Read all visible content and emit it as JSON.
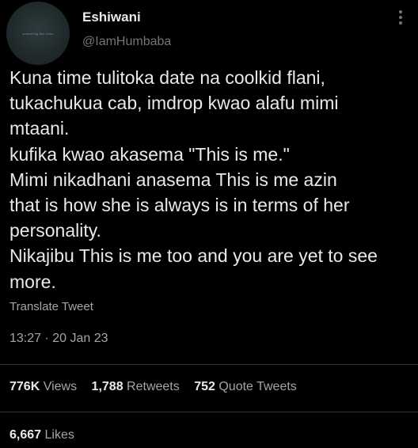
{
  "author": {
    "avatar_text": "something the voice",
    "display_name": "Eshiwani",
    "handle": "@IamHumbaba"
  },
  "tweet": {
    "lines": [
      "Kuna time tulitoka date na coolkid flani,",
      "tukachukua cab, imdrop kwao alafu mimi",
      "mtaani.",
      "kufika kwao akasema \"This is me.\"",
      "Mimi nikadhani anasema This is me azin",
      "that is how she is always is in terms of her",
      "personality.",
      "Nikajibu This is me too and you are yet to see",
      "more."
    ],
    "translate_label": "Translate Tweet",
    "timestamp": "13:27 · 20 Jan 23"
  },
  "stats": {
    "views_count": "776K",
    "views_label": "Views",
    "retweets_count": "1,788",
    "retweets_label": "Retweets",
    "quotes_count": "752",
    "quotes_label": "Quote Tweets",
    "likes_count": "6,667",
    "likes_label": "Likes"
  },
  "colors": {
    "background": "#000000",
    "primary_text": "#e7e9ea",
    "secondary_text": "#71767b",
    "divider": "#2f3336"
  },
  "icons": {
    "more": "more-vertical-icon"
  }
}
